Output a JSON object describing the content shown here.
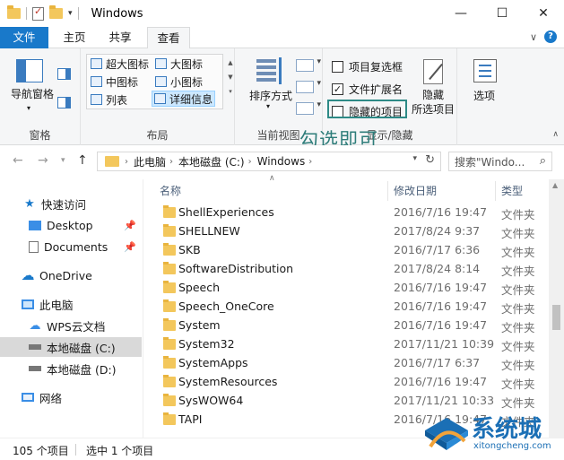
{
  "window": {
    "title": "Windows"
  },
  "tabs": {
    "file": "文件",
    "home": "主页",
    "share": "共享",
    "view": "查看"
  },
  "ribbon": {
    "pane_group": {
      "nav_pane": "导航窗格",
      "label": "窗格"
    },
    "layout_group": {
      "items": [
        {
          "label": "超大图标"
        },
        {
          "label": "大图标"
        },
        {
          "label": "中图标"
        },
        {
          "label": "小图标"
        },
        {
          "label": "列表"
        },
        {
          "label": "详细信息",
          "selected": true
        }
      ],
      "label": "布局"
    },
    "view_group": {
      "sort_by": "排序方式",
      "label": "当前视图"
    },
    "show_hide_group": {
      "item_checkboxes": {
        "label": "项目复选框",
        "checked": false
      },
      "file_extensions": {
        "label": "文件扩展名",
        "checked": true
      },
      "hidden_items": {
        "label": "隐藏的项目",
        "checked": false
      },
      "hide_selected": "隐藏\n所选项目",
      "label": "显示/隐藏"
    },
    "options": {
      "label": "选项"
    }
  },
  "annotation": "勾选即可",
  "address": {
    "crumbs": [
      "此电脑",
      "本地磁盘 (C:)",
      "Windows"
    ],
    "search_placeholder": "搜索\"Windo..."
  },
  "nav": {
    "items": [
      {
        "label": "快速访问",
        "icon": "star-icon"
      },
      {
        "label": "Desktop",
        "icon": "desktop-icon",
        "pinned": true
      },
      {
        "label": "Documents",
        "icon": "documents-icon",
        "pinned": true
      },
      {
        "label": "OneDrive",
        "icon": "cloud-icon"
      },
      {
        "label": "此电脑",
        "icon": "computer-icon"
      },
      {
        "label": "WPS云文档",
        "icon": "cloud-outline-icon"
      },
      {
        "label": "本地磁盘 (C:)",
        "icon": "drive-icon",
        "selected": true
      },
      {
        "label": "本地磁盘 (D:)",
        "icon": "drive-icon"
      },
      {
        "label": "网络",
        "icon": "network-icon"
      }
    ]
  },
  "columns": {
    "name": "名称",
    "date": "修改日期",
    "type": "类型"
  },
  "files": [
    {
      "name": "ShellExperiences",
      "date": "2016/7/16 19:47",
      "type": "文件夹"
    },
    {
      "name": "SHELLNEW",
      "date": "2017/8/24 9:37",
      "type": "文件夹"
    },
    {
      "name": "SKB",
      "date": "2016/7/17 6:36",
      "type": "文件夹"
    },
    {
      "name": "SoftwareDistribution",
      "date": "2017/8/24 8:14",
      "type": "文件夹"
    },
    {
      "name": "Speech",
      "date": "2016/7/16 19:47",
      "type": "文件夹"
    },
    {
      "name": "Speech_OneCore",
      "date": "2016/7/16 19:47",
      "type": "文件夹"
    },
    {
      "name": "System",
      "date": "2016/7/16 19:47",
      "type": "文件夹"
    },
    {
      "name": "System32",
      "date": "2017/11/21 10:39",
      "type": "文件夹"
    },
    {
      "name": "SystemApps",
      "date": "2016/7/17 6:37",
      "type": "文件夹"
    },
    {
      "name": "SystemResources",
      "date": "2016/7/16 19:47",
      "type": "文件夹"
    },
    {
      "name": "SysWOW64",
      "date": "2017/11/21 10:33",
      "type": "文件夹"
    },
    {
      "name": "TAPI",
      "date": "2016/7/16 19:47",
      "type": "文件夹"
    }
  ],
  "status": {
    "count": "105 个项目",
    "selected": "选中 1 个项目"
  },
  "watermark": {
    "text": "系统城",
    "url": "xitongcheng.com"
  },
  "colors": {
    "accent": "#1979ca",
    "annotation": "#2e7d7a",
    "folder": "#f3c75c",
    "selection": "#d9d9d9"
  }
}
